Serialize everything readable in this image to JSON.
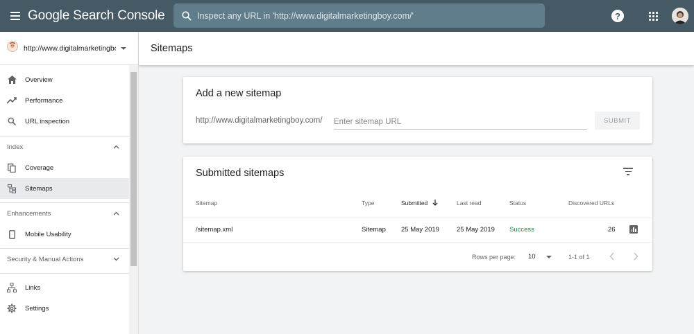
{
  "header": {
    "brand": "Google Search Console",
    "search_placeholder": "Inspect any URL in 'http://www.digitalmarketingboy.com/'",
    "help_label": "?"
  },
  "property": {
    "label": "http://www.digitalmarketingboy.com/"
  },
  "sidebar": {
    "top_items": [
      {
        "label": "Overview",
        "icon": "home-icon"
      },
      {
        "label": "Performance",
        "icon": "trending-up-icon"
      },
      {
        "label": "URL inspection",
        "icon": "search-icon"
      }
    ],
    "index_section": {
      "label": "Index",
      "items": [
        {
          "label": "Coverage",
          "icon": "copy-icon"
        },
        {
          "label": "Sitemaps",
          "icon": "sitemap-icon",
          "active": true
        }
      ]
    },
    "enhancements_section": {
      "label": "Enhancements",
      "items": [
        {
          "label": "Mobile Usability",
          "icon": "phone-icon"
        }
      ]
    },
    "security_section": {
      "label": "Security & Manual Actions"
    },
    "bottom_items": [
      {
        "label": "Links",
        "icon": "links-icon"
      },
      {
        "label": "Settings",
        "icon": "gear-icon"
      }
    ]
  },
  "page": {
    "title": "Sitemaps"
  },
  "add_sitemap": {
    "title": "Add a new sitemap",
    "url_prefix": "http://www.digitalmarketingboy.com/",
    "input_placeholder": "Enter sitemap URL",
    "input_value": "",
    "submit_label": "SUBMIT"
  },
  "submitted": {
    "title": "Submitted sitemaps",
    "columns": [
      "Sitemap",
      "Type",
      "Submitted",
      "Last read",
      "Status",
      "Discovered URLs"
    ],
    "rows": [
      {
        "sitemap": "/sitemap.xml",
        "type": "Sitemap",
        "submitted": "25 May 2019",
        "last_read": "25 May 2019",
        "status": "Success",
        "discovered": "26"
      }
    ],
    "footer": {
      "rows_per_page_label": "Rows per page:",
      "rows_per_page_value": "10",
      "range": "1-1 of 1"
    }
  },
  "colors": {
    "topbar": "#455a64",
    "search_bg": "#607d8b",
    "success": "#1e8e3e",
    "active_nav": "#e8eaed"
  }
}
